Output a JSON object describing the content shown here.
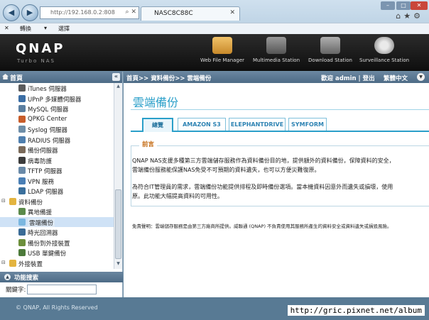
{
  "browser": {
    "url": "http://192.168.0.2:808",
    "tab_title": "NASC8C88C",
    "cmd_convert": "轉換",
    "cmd_select": "選擇"
  },
  "header": {
    "logo": "QNAP",
    "subtitle": "Turbo NAS",
    "icons": [
      {
        "label": "Web File Manager",
        "icon": "folder-globe-icon"
      },
      {
        "label": "Multimedia Station",
        "icon": "film-icon"
      },
      {
        "label": "Download Station",
        "icon": "download-icon"
      },
      {
        "label": "Surveillance Station",
        "icon": "camera-icon"
      }
    ]
  },
  "sidebar": {
    "head": "首頁",
    "items": [
      {
        "label": "iTunes 伺服器",
        "color": "#5c5c5c",
        "indent": 1
      },
      {
        "label": "UPnP 多媒體伺服器",
        "color": "#3b6ea5",
        "indent": 1
      },
      {
        "label": "MySQL 伺服器",
        "color": "#5a7ea0",
        "indent": 1
      },
      {
        "label": "QPKG Center",
        "color": "#c85d2b",
        "indent": 1
      },
      {
        "label": "Syslog 伺服器",
        "color": "#6e8ea8",
        "indent": 1
      },
      {
        "label": "RADIUS 伺服器",
        "color": "#4f7fae",
        "indent": 1
      },
      {
        "label": "備份伺服器",
        "color": "#7a6a5a",
        "indent": 1
      },
      {
        "label": "病毒防護",
        "color": "#3c3c3c",
        "indent": 1
      },
      {
        "label": "TFTP 伺服器",
        "color": "#6a8aa8",
        "indent": 1
      },
      {
        "label": "VPN 服務",
        "color": "#4a7fb5",
        "indent": 1
      },
      {
        "label": "LDAP 伺服器",
        "color": "#3a6f9c",
        "indent": 1
      },
      {
        "label": "資料備份",
        "color": "#e3b440",
        "indent": 0
      },
      {
        "label": "異地備援",
        "color": "#5b8a4a",
        "indent": 1
      },
      {
        "label": "雲端備份",
        "color": "#7bb7e0",
        "indent": 1,
        "selected": true
      },
      {
        "label": "時光回溯器",
        "color": "#3a6b96",
        "indent": 1
      },
      {
        "label": "備份到外接裝置",
        "color": "#6c8f3c",
        "indent": 1
      },
      {
        "label": "USB 單鍵備份",
        "color": "#4c7a3a",
        "indent": 1
      },
      {
        "label": "外接裝置",
        "color": "#e3b440",
        "indent": 0
      }
    ],
    "function_search": "功能搜索",
    "keyword_label": "關鍵字:"
  },
  "main": {
    "breadcrumb": "首頁>> 資料備份>> 雲端備份",
    "welcome": "歡迎 admin | 登出",
    "language": "繁體中文",
    "title": "雲端備份",
    "tabs": [
      "總覽",
      "AMAZON S3",
      "ELEPHANTDRIVE",
      "SYMFORM"
    ],
    "legend": "前言",
    "para1_line1": "QNAP NAS支援多種第三方雲端儲存服務作為資料備份目的地，提供額外的資料備份，保障資料的安全，",
    "para1_line2": "雲端備份服務能保護NAS免受不可預期的資料遺失，也可以方便災難復原。",
    "para2_line1": "為符合IT管理員的需求，雲端備份功能提供排程及即時備份選項。當本機資料因意外而遺失或損壞，使用",
    "para2_line2": "原。此功能大幅提高資料的可用性。",
    "disclaimer": "免責聲明：雲端儲存服務是由第三方廠商所提供。威聯通 (QNAP) 不負責使用其服務所產生的資料安全或資料遺失或損毀風險。"
  },
  "footer": {
    "copyright": "© QNAP, All Rights Reserved",
    "watermark": "http://gric.pixnet.net/album"
  }
}
